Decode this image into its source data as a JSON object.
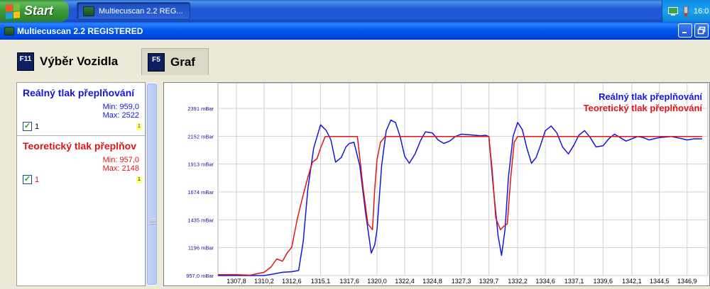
{
  "taskbar": {
    "start_label": "Start",
    "task_button_label": "Multiecuscan 2.2 REG...",
    "clock_partial": "16:0"
  },
  "window": {
    "title": "Multiecuscan 2.2 REGISTERED"
  },
  "tabs": [
    {
      "key": "F11",
      "label": "Výběr Vozidla",
      "active": false
    },
    {
      "key": "F5",
      "label": "Graf",
      "active": true
    }
  ],
  "legend": {
    "series": [
      {
        "name": "Reálný tlak přeplňování",
        "min_label": "Min: 959,0",
        "max_label": "Max: 2522",
        "checkbox_label": "1",
        "tag": "1",
        "color": "#1414e0"
      },
      {
        "name": "Teoretický tlak přeplňov",
        "min_label": "Min: 957,0",
        "max_label": "Max: 2148",
        "checkbox_label": "1",
        "tag": "1",
        "color": "#e01414"
      }
    ]
  },
  "colors": {
    "real": "#1414e0",
    "theoretical": "#e01414",
    "grid": "#d0d0d0",
    "taskbar": "#2157d7",
    "titlebar": "#0058ee"
  },
  "chart_data": {
    "type": "line",
    "legend_entries": [
      "Reálný tlak přeplňování",
      "Teoretický tlak přeplňování"
    ],
    "legend_position": "top-right",
    "grid": true,
    "y_tick_labels": [
      "2391 mBar",
      "2152 mBar",
      "1913 mBar",
      "1674 mBar",
      "1435 mBar",
      "1196 mBar",
      "957,0 mBar"
    ],
    "y_ticks": [
      2391,
      2152,
      1913,
      1674,
      1435,
      1196,
      957
    ],
    "ylim": [
      957,
      2391
    ],
    "x_tick_labels": [
      "1307,8",
      "1310,2",
      "1312,6",
      "1315,1",
      "1317,6",
      "1320,0",
      "1322,4",
      "1324,8",
      "1327,3",
      "1329,7",
      "1332,2",
      "1334,6",
      "1337,1",
      "1339,6",
      "1342,1",
      "1344,5",
      "1346,9"
    ],
    "x_ticks": [
      1307.8,
      1310.2,
      1312.6,
      1315.1,
      1317.6,
      1320.0,
      1322.4,
      1324.8,
      1327.3,
      1329.7,
      1332.2,
      1334.6,
      1337.1,
      1339.6,
      1342.1,
      1344.5,
      1346.9
    ],
    "xlim": [
      1306.2,
      1348.7
    ],
    "series": [
      {
        "name": "Reálný tlak přeplňování",
        "x": [
          1306.2,
          1307.8,
          1309.0,
          1310.2,
          1311.0,
          1311.8,
          1312.6,
          1313.2,
          1313.6,
          1314.0,
          1314.5,
          1315.1,
          1315.6,
          1316.0,
          1316.4,
          1316.9,
          1317.3,
          1317.6,
          1318.0,
          1318.5,
          1319.0,
          1319.5,
          1319.8,
          1320.0,
          1320.4,
          1320.8,
          1321.2,
          1321.6,
          1322.0,
          1322.4,
          1322.8,
          1323.3,
          1323.8,
          1324.2,
          1324.8,
          1325.3,
          1325.8,
          1326.3,
          1326.8,
          1327.3,
          1328.0,
          1329.0,
          1329.4,
          1329.7,
          1330.1,
          1330.5,
          1330.8,
          1331.1,
          1331.4,
          1331.8,
          1332.2,
          1332.6,
          1333.0,
          1333.4,
          1333.8,
          1334.2,
          1334.6,
          1335.1,
          1335.6,
          1336.1,
          1336.6,
          1337.1,
          1337.5,
          1338.0,
          1338.5,
          1339.0,
          1339.6,
          1340.1,
          1340.6,
          1341.1,
          1341.6,
          1342.1,
          1342.6,
          1343.1,
          1343.6,
          1344.0,
          1344.5,
          1345.0,
          1345.5,
          1346.0,
          1346.5,
          1346.9,
          1347.5,
          1348.2
        ],
        "y": [
          957,
          957,
          957,
          957,
          970,
          985,
          990,
          1000,
          1250,
          1700,
          2050,
          2250,
          2200,
          2120,
          1930,
          1970,
          2060,
          2090,
          2100,
          1900,
          1500,
          1150,
          1220,
          1350,
          1900,
          2200,
          2290,
          2270,
          2150,
          1980,
          1920,
          2000,
          2120,
          2190,
          2180,
          2120,
          2090,
          2110,
          2150,
          2170,
          2165,
          2155,
          2160,
          2150,
          1700,
          1300,
          1130,
          1350,
          1800,
          2150,
          2270,
          2210,
          2050,
          1920,
          1970,
          2080,
          2200,
          2240,
          2180,
          2060,
          2000,
          2080,
          2160,
          2200,
          2140,
          2060,
          2070,
          2130,
          2170,
          2140,
          2110,
          2130,
          2150,
          2140,
          2120,
          2130,
          2140,
          2145,
          2150,
          2140,
          2130,
          2120,
          2130,
          2130
        ],
        "color": "#1414e0"
      },
      {
        "name": "Teoretický tlak přeplňování",
        "x": [
          1306.2,
          1307.8,
          1309.0,
          1310.2,
          1310.8,
          1311.3,
          1311.8,
          1312.2,
          1312.6,
          1313.1,
          1313.6,
          1314.0,
          1314.4,
          1314.8,
          1315.1,
          1315.5,
          1316.5,
          1317.6,
          1318.3,
          1318.8,
          1319.2,
          1319.6,
          1319.8,
          1320.0,
          1320.3,
          1320.7,
          1321.2,
          1322.4,
          1324.8,
          1327.3,
          1329.7,
          1330.0,
          1330.3,
          1330.7,
          1331.0,
          1331.3,
          1331.6,
          1331.9,
          1332.2,
          1333.0,
          1334.6,
          1337.1,
          1339.6,
          1342.1,
          1344.5,
          1346.9,
          1348.2
        ],
        "y": [
          965,
          965,
          960,
          985,
          1030,
          1100,
          1080,
          1150,
          1200,
          1450,
          1650,
          1800,
          1930,
          1960,
          2050,
          2150,
          2150,
          2150,
          2150,
          1700,
          1400,
          1350,
          1700,
          1950,
          2100,
          2150,
          2150,
          2150,
          2150,
          2150,
          2150,
          1850,
          1450,
          1350,
          1380,
          1400,
          1800,
          2100,
          2150,
          2150,
          2150,
          2150,
          2150,
          2150,
          2150,
          2150,
          2150
        ],
        "color": "#e01414"
      }
    ]
  }
}
